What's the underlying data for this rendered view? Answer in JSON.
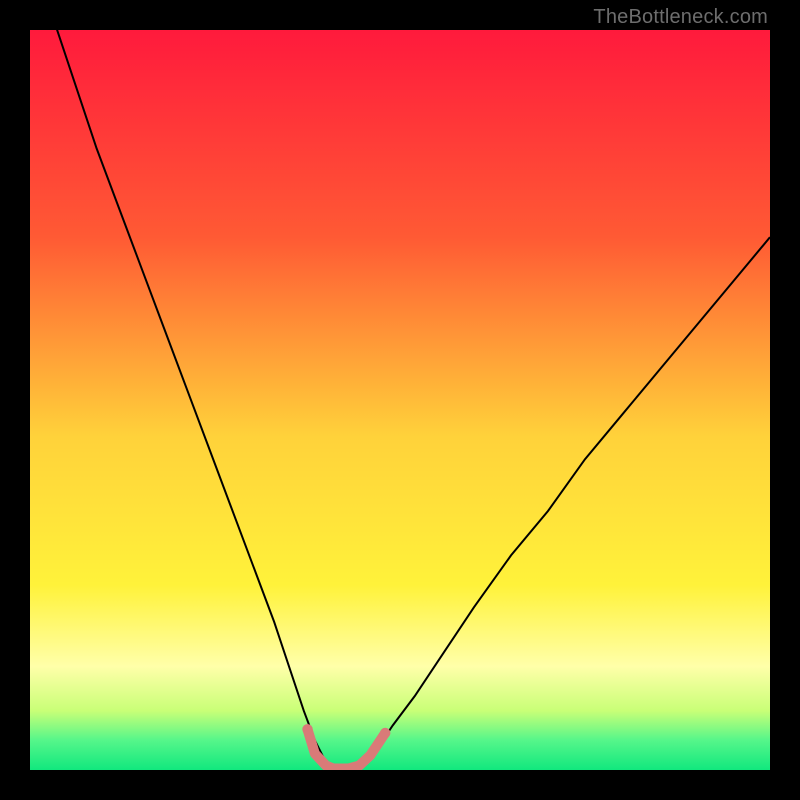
{
  "watermark": "TheBottleneck.com",
  "chart_data": {
    "type": "line",
    "title": "",
    "xlabel": "",
    "ylabel": "",
    "xlim": [
      0,
      100
    ],
    "ylim": [
      0,
      100
    ],
    "background_gradient": {
      "stops": [
        {
          "offset": 0.0,
          "color": "#ff1a3c"
        },
        {
          "offset": 0.28,
          "color": "#ff5a34"
        },
        {
          "offset": 0.55,
          "color": "#ffd23a"
        },
        {
          "offset": 0.75,
          "color": "#fff23a"
        },
        {
          "offset": 0.86,
          "color": "#ffffa9"
        },
        {
          "offset": 0.92,
          "color": "#c9ff77"
        },
        {
          "offset": 0.96,
          "color": "#55f68a"
        },
        {
          "offset": 1.0,
          "color": "#11e87e"
        }
      ]
    },
    "series": [
      {
        "name": "bottleneck-curve",
        "color": "#000000",
        "width": 2,
        "x": [
          0,
          3,
          6,
          9,
          12,
          15,
          18,
          21,
          24,
          27,
          30,
          33,
          35,
          37,
          38.5,
          40,
          41,
          42,
          43.5,
          45,
          47,
          49,
          52,
          56,
          60,
          65,
          70,
          75,
          80,
          85,
          90,
          95,
          100
        ],
        "y": [
          110,
          102,
          93,
          84,
          76,
          68,
          60,
          52,
          44,
          36,
          28,
          20,
          14,
          8,
          4,
          1,
          0,
          0,
          0,
          1,
          3,
          6,
          10,
          16,
          22,
          29,
          35,
          42,
          48,
          54,
          60,
          66,
          72
        ]
      },
      {
        "name": "valley-marker",
        "color": "#d97a78",
        "width": 10,
        "linecap": "round",
        "x": [
          37.5,
          38.5,
          40,
          41,
          42,
          43,
          44.5,
          46,
          48
        ],
        "y": [
          5.5,
          2.2,
          0.6,
          0.2,
          0.2,
          0.2,
          0.6,
          2.0,
          5.0
        ]
      }
    ],
    "markers": [
      {
        "x": 37.5,
        "y": 5.5,
        "r": 5.2,
        "color": "#d97a78"
      },
      {
        "x": 48.0,
        "y": 5.0,
        "r": 5.2,
        "color": "#d97a78"
      }
    ]
  }
}
